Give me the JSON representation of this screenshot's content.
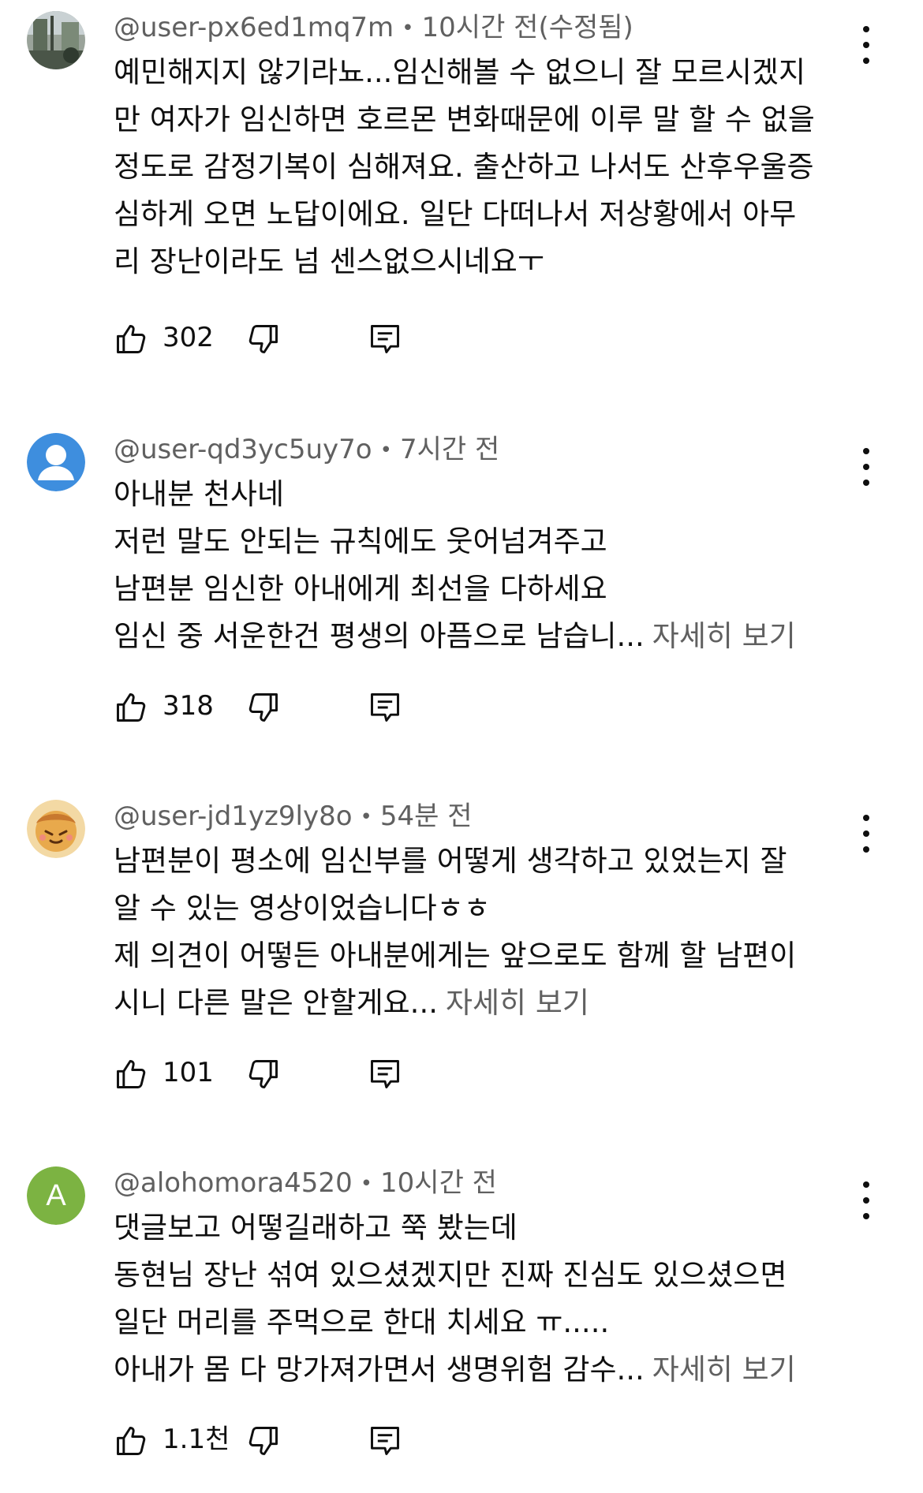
{
  "comments": [
    {
      "handle": "@user-px6ed1mq7m",
      "time": "10시간 전(수정됨)",
      "lines": [
        "예민해지지 않기라뇨...임신해볼 수 없으니 잘 모르시겠지",
        "만 여자가 임신하면 호르몬 변화때문에 이루 말 할 수 없을",
        "정도로 감정기복이 심해져요. 출산하고 나서도 산후우울증",
        "심하게 오면 노답이에요. 일단 다떠나서 저상황에서 아무",
        "리 장난이라도 넘 센스없으시네요ㅜ"
      ],
      "more": "",
      "likes": "302",
      "avatar_icon": "photo-avatar-icon"
    },
    {
      "handle": "@user-qd3yc5uy7o",
      "time": "7시간 전",
      "lines": [
        "아내분 천사네",
        "저런 말도 안되는 규칙에도 웃어넘겨주고",
        "남편분 임신한 아내에게 최선을 다하세요",
        "임신 중 서운한건 평생의 아픔으로 남습니..."
      ],
      "more": "자세히 보기",
      "likes": "318",
      "avatar_icon": "default-user-avatar-icon"
    },
    {
      "handle": "@user-jd1yz9ly8o",
      "time": "54분 전",
      "lines": [
        "남편분이 평소에 임신부를 어떻게 생각하고 있었는지 잘",
        "알 수 있는 영상이었습니다ㅎㅎ",
        "제 의견이 어떻든 아내분에게는 앞으로도 함께 할 남편이",
        "시니 다른 말은 안할게요..."
      ],
      "more": "자세히 보기",
      "likes": "101",
      "avatar_icon": "cartoon-avatar-icon"
    },
    {
      "handle": "@alohomora4520",
      "time": "10시간 전",
      "lines": [
        "댓글보고 어떻길래하고 쭉 봤는데",
        "동현님 장난 섞여 있으셨겠지만 진짜 진심도 있으셨으면",
        "일단 머리를 주먹으로 한대 치세요 ㅠ.....",
        "아내가 몸 다 망가져가면서 생명위험 감수..."
      ],
      "more": "자세히 보기",
      "likes": "1.1천",
      "avatar_letter": "A",
      "avatar_color": "#7cb342"
    }
  ],
  "icons": {
    "like": "thumbs-up-icon",
    "dislike": "thumbs-down-icon",
    "reply": "reply-comment-icon",
    "menu": "more-vert-icon"
  },
  "colors": {
    "text": "#0f0f0f",
    "secondary": "#606060",
    "default_avatar": "#3e8ede"
  }
}
